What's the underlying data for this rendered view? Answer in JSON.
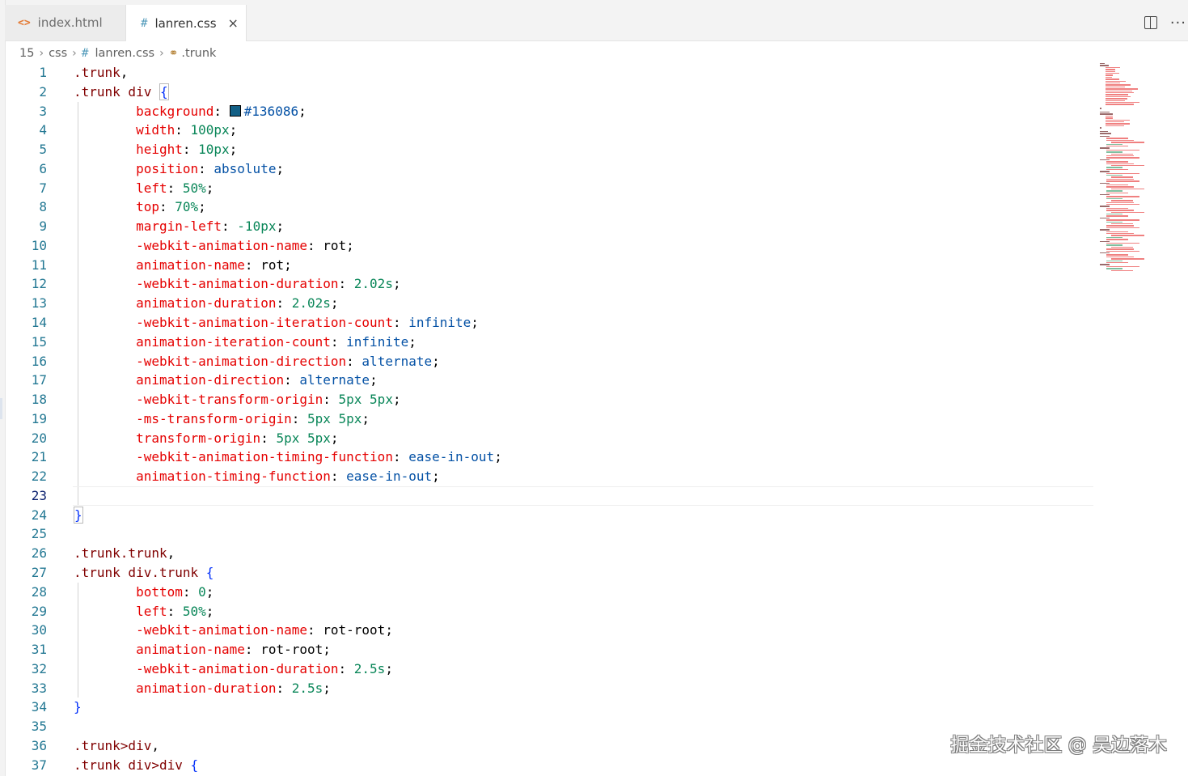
{
  "tabs": [
    {
      "icon": "<>",
      "label": "index.html",
      "active": false
    },
    {
      "icon": "#",
      "label": "lanren.css",
      "active": true,
      "close": "×"
    }
  ],
  "tab_actions": {
    "more": "···"
  },
  "breadcrumb": {
    "line": "15",
    "folder": "css",
    "file_icon": "#",
    "file": "lanren.css",
    "symbol": ".trunk"
  },
  "editor": {
    "current_line": 23,
    "swatch_color": "#136086",
    "lines": [
      {
        "n": "1",
        "tokens": [
          {
            "c": "sel",
            "t": ".trunk"
          },
          {
            "c": "punct",
            "t": ","
          }
        ]
      },
      {
        "n": "2",
        "tokens": [
          {
            "c": "sel",
            "t": ".trunk div"
          },
          {
            "c": "punct",
            "t": " "
          },
          {
            "c": "brace brace-box",
            "t": "{"
          }
        ]
      },
      {
        "n": "3",
        "tokens": [
          {
            "c": "punct",
            "t": "        "
          },
          {
            "c": "prop",
            "t": "background"
          },
          {
            "c": "punct",
            "t": ": "
          },
          {
            "c": "swatch",
            "t": ""
          },
          {
            "c": "kw",
            "t": "#136086"
          },
          {
            "c": "punct",
            "t": ";"
          }
        ]
      },
      {
        "n": "4",
        "tokens": [
          {
            "c": "punct",
            "t": "        "
          },
          {
            "c": "prop",
            "t": "width"
          },
          {
            "c": "punct",
            "t": ": "
          },
          {
            "c": "num",
            "t": "100px"
          },
          {
            "c": "punct",
            "t": ";"
          }
        ]
      },
      {
        "n": "5",
        "tokens": [
          {
            "c": "punct",
            "t": "        "
          },
          {
            "c": "prop",
            "t": "height"
          },
          {
            "c": "punct",
            "t": ": "
          },
          {
            "c": "num",
            "t": "10px"
          },
          {
            "c": "punct",
            "t": ";"
          }
        ]
      },
      {
        "n": "6",
        "tokens": [
          {
            "c": "punct",
            "t": "        "
          },
          {
            "c": "prop",
            "t": "position"
          },
          {
            "c": "punct",
            "t": ": "
          },
          {
            "c": "kw",
            "t": "absolute"
          },
          {
            "c": "punct",
            "t": ";"
          }
        ]
      },
      {
        "n": "7",
        "tokens": [
          {
            "c": "punct",
            "t": "        "
          },
          {
            "c": "prop",
            "t": "left"
          },
          {
            "c": "punct",
            "t": ": "
          },
          {
            "c": "num",
            "t": "50%"
          },
          {
            "c": "punct",
            "t": ";"
          }
        ]
      },
      {
        "n": "8",
        "tokens": [
          {
            "c": "punct",
            "t": "        "
          },
          {
            "c": "prop",
            "t": "top"
          },
          {
            "c": "punct",
            "t": ": "
          },
          {
            "c": "num",
            "t": "70%"
          },
          {
            "c": "punct",
            "t": ";"
          }
        ]
      },
      {
        "n": "9",
        "tokens": [
          {
            "c": "punct",
            "t": "        "
          },
          {
            "c": "prop",
            "t": "margin-left"
          },
          {
            "c": "punct",
            "t": ": "
          },
          {
            "c": "num",
            "t": "-10px"
          },
          {
            "c": "punct",
            "t": ";"
          }
        ]
      },
      {
        "n": "10",
        "tokens": [
          {
            "c": "punct",
            "t": "        "
          },
          {
            "c": "prop",
            "t": "-webkit-animation-name"
          },
          {
            "c": "punct",
            "t": ": rot;"
          }
        ]
      },
      {
        "n": "11",
        "tokens": [
          {
            "c": "punct",
            "t": "        "
          },
          {
            "c": "prop",
            "t": "animation-name"
          },
          {
            "c": "punct",
            "t": ": rot;"
          }
        ]
      },
      {
        "n": "12",
        "tokens": [
          {
            "c": "punct",
            "t": "        "
          },
          {
            "c": "prop",
            "t": "-webkit-animation-duration"
          },
          {
            "c": "punct",
            "t": ": "
          },
          {
            "c": "num",
            "t": "2.02s"
          },
          {
            "c": "punct",
            "t": ";"
          }
        ]
      },
      {
        "n": "13",
        "tokens": [
          {
            "c": "punct",
            "t": "        "
          },
          {
            "c": "prop",
            "t": "animation-duration"
          },
          {
            "c": "punct",
            "t": ": "
          },
          {
            "c": "num",
            "t": "2.02s"
          },
          {
            "c": "punct",
            "t": ";"
          }
        ]
      },
      {
        "n": "14",
        "tokens": [
          {
            "c": "punct",
            "t": "        "
          },
          {
            "c": "prop",
            "t": "-webkit-animation-iteration-count"
          },
          {
            "c": "punct",
            "t": ": "
          },
          {
            "c": "kw",
            "t": "infinite"
          },
          {
            "c": "punct",
            "t": ";"
          }
        ]
      },
      {
        "n": "15",
        "tokens": [
          {
            "c": "punct",
            "t": "        "
          },
          {
            "c": "prop",
            "t": "animation-iteration-count"
          },
          {
            "c": "punct",
            "t": ": "
          },
          {
            "c": "kw",
            "t": "infinite"
          },
          {
            "c": "punct",
            "t": ";"
          }
        ]
      },
      {
        "n": "16",
        "tokens": [
          {
            "c": "punct",
            "t": "        "
          },
          {
            "c": "prop",
            "t": "-webkit-animation-direction"
          },
          {
            "c": "punct",
            "t": ": "
          },
          {
            "c": "kw",
            "t": "alternate"
          },
          {
            "c": "punct",
            "t": ";"
          }
        ]
      },
      {
        "n": "17",
        "tokens": [
          {
            "c": "punct",
            "t": "        "
          },
          {
            "c": "prop",
            "t": "animation-direction"
          },
          {
            "c": "punct",
            "t": ": "
          },
          {
            "c": "kw",
            "t": "alternate"
          },
          {
            "c": "punct",
            "t": ";"
          }
        ]
      },
      {
        "n": "18",
        "tokens": [
          {
            "c": "punct",
            "t": "        "
          },
          {
            "c": "prop",
            "t": "-webkit-transform-origin"
          },
          {
            "c": "punct",
            "t": ": "
          },
          {
            "c": "num",
            "t": "5px 5px"
          },
          {
            "c": "punct",
            "t": ";"
          }
        ]
      },
      {
        "n": "19",
        "tokens": [
          {
            "c": "punct",
            "t": "        "
          },
          {
            "c": "prop",
            "t": "-ms-transform-origin"
          },
          {
            "c": "punct",
            "t": ": "
          },
          {
            "c": "num",
            "t": "5px 5px"
          },
          {
            "c": "punct",
            "t": ";"
          }
        ]
      },
      {
        "n": "20",
        "tokens": [
          {
            "c": "punct",
            "t": "        "
          },
          {
            "c": "prop",
            "t": "transform-origin"
          },
          {
            "c": "punct",
            "t": ": "
          },
          {
            "c": "num",
            "t": "5px 5px"
          },
          {
            "c": "punct",
            "t": ";"
          }
        ]
      },
      {
        "n": "21",
        "tokens": [
          {
            "c": "punct",
            "t": "        "
          },
          {
            "c": "prop",
            "t": "-webkit-animation-timing-function"
          },
          {
            "c": "punct",
            "t": ": "
          },
          {
            "c": "kw",
            "t": "ease-in-out"
          },
          {
            "c": "punct",
            "t": ";"
          }
        ]
      },
      {
        "n": "22",
        "tokens": [
          {
            "c": "punct",
            "t": "        "
          },
          {
            "c": "prop",
            "t": "animation-timing-function"
          },
          {
            "c": "punct",
            "t": ": "
          },
          {
            "c": "kw",
            "t": "ease-in-out"
          },
          {
            "c": "punct",
            "t": ";"
          }
        ]
      },
      {
        "n": "23",
        "tokens": []
      },
      {
        "n": "24",
        "tokens": [
          {
            "c": "brace brace-box",
            "t": "}"
          }
        ]
      },
      {
        "n": "25",
        "tokens": []
      },
      {
        "n": "26",
        "tokens": [
          {
            "c": "sel",
            "t": ".trunk.trunk"
          },
          {
            "c": "punct",
            "t": ","
          }
        ]
      },
      {
        "n": "27",
        "tokens": [
          {
            "c": "sel",
            "t": ".trunk div.trunk"
          },
          {
            "c": "punct",
            "t": " "
          },
          {
            "c": "brace",
            "t": "{"
          }
        ]
      },
      {
        "n": "28",
        "tokens": [
          {
            "c": "punct",
            "t": "        "
          },
          {
            "c": "prop",
            "t": "bottom"
          },
          {
            "c": "punct",
            "t": ": "
          },
          {
            "c": "num",
            "t": "0"
          },
          {
            "c": "punct",
            "t": ";"
          }
        ]
      },
      {
        "n": "29",
        "tokens": [
          {
            "c": "punct",
            "t": "        "
          },
          {
            "c": "prop",
            "t": "left"
          },
          {
            "c": "punct",
            "t": ": "
          },
          {
            "c": "num",
            "t": "50%"
          },
          {
            "c": "punct",
            "t": ";"
          }
        ]
      },
      {
        "n": "30",
        "tokens": [
          {
            "c": "punct",
            "t": "        "
          },
          {
            "c": "prop",
            "t": "-webkit-animation-name"
          },
          {
            "c": "punct",
            "t": ": rot-root;"
          }
        ]
      },
      {
        "n": "31",
        "tokens": [
          {
            "c": "punct",
            "t": "        "
          },
          {
            "c": "prop",
            "t": "animation-name"
          },
          {
            "c": "punct",
            "t": ": rot-root;"
          }
        ]
      },
      {
        "n": "32",
        "tokens": [
          {
            "c": "punct",
            "t": "        "
          },
          {
            "c": "prop",
            "t": "-webkit-animation-duration"
          },
          {
            "c": "punct",
            "t": ": "
          },
          {
            "c": "num",
            "t": "2.5s"
          },
          {
            "c": "punct",
            "t": ";"
          }
        ]
      },
      {
        "n": "33",
        "tokens": [
          {
            "c": "punct",
            "t": "        "
          },
          {
            "c": "prop",
            "t": "animation-duration"
          },
          {
            "c": "punct",
            "t": ": "
          },
          {
            "c": "num",
            "t": "2.5s"
          },
          {
            "c": "punct",
            "t": ";"
          }
        ]
      },
      {
        "n": "34",
        "tokens": [
          {
            "c": "brace",
            "t": "}"
          }
        ]
      },
      {
        "n": "35",
        "tokens": []
      },
      {
        "n": "36",
        "tokens": [
          {
            "c": "sel",
            "t": ".trunk>div"
          },
          {
            "c": "punct",
            "t": ","
          }
        ]
      },
      {
        "n": "37",
        "tokens": [
          {
            "c": "sel",
            "t": ".trunk div>div"
          },
          {
            "c": "punct",
            "t": " "
          },
          {
            "c": "brace",
            "t": "{"
          }
        ]
      }
    ]
  },
  "watermark": "掘金技术社区 @ 吴边落木"
}
